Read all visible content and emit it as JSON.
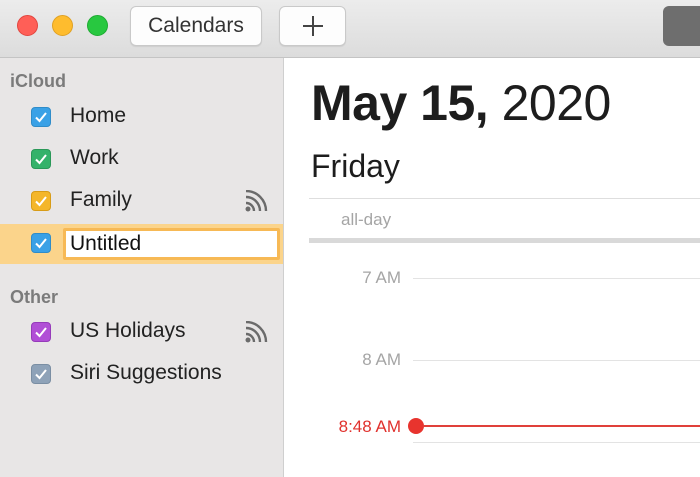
{
  "toolbar": {
    "calendars_label": "Calendars",
    "add_icon": "plus-icon"
  },
  "sidebar": {
    "sections": [
      {
        "title": "iCloud",
        "items": [
          {
            "label": "Home",
            "color": "#3aa1e6",
            "checked": true
          },
          {
            "label": "Work",
            "color": "#34b26a",
            "checked": true
          },
          {
            "label": "Family",
            "color": "#f4b62a",
            "checked": true,
            "shared": true
          },
          {
            "label": "Untitled",
            "color": "#3aa1e6",
            "checked": true,
            "selected": true,
            "editing": true
          }
        ]
      },
      {
        "title": "Other",
        "items": [
          {
            "label": "US Holidays",
            "color": "#b14fd6",
            "checked": true,
            "shared": true
          },
          {
            "label": "Siri Suggestions",
            "color": "#8ea2b8",
            "checked": true
          }
        ]
      }
    ]
  },
  "day_view": {
    "date_bold": "May 15,",
    "year": "2020",
    "weekday": "Friday",
    "allday_label": "all-day",
    "hours": [
      "7 AM",
      "8 AM"
    ],
    "current_time": "8:48 AM",
    "current_time_color": "#e0312d"
  }
}
